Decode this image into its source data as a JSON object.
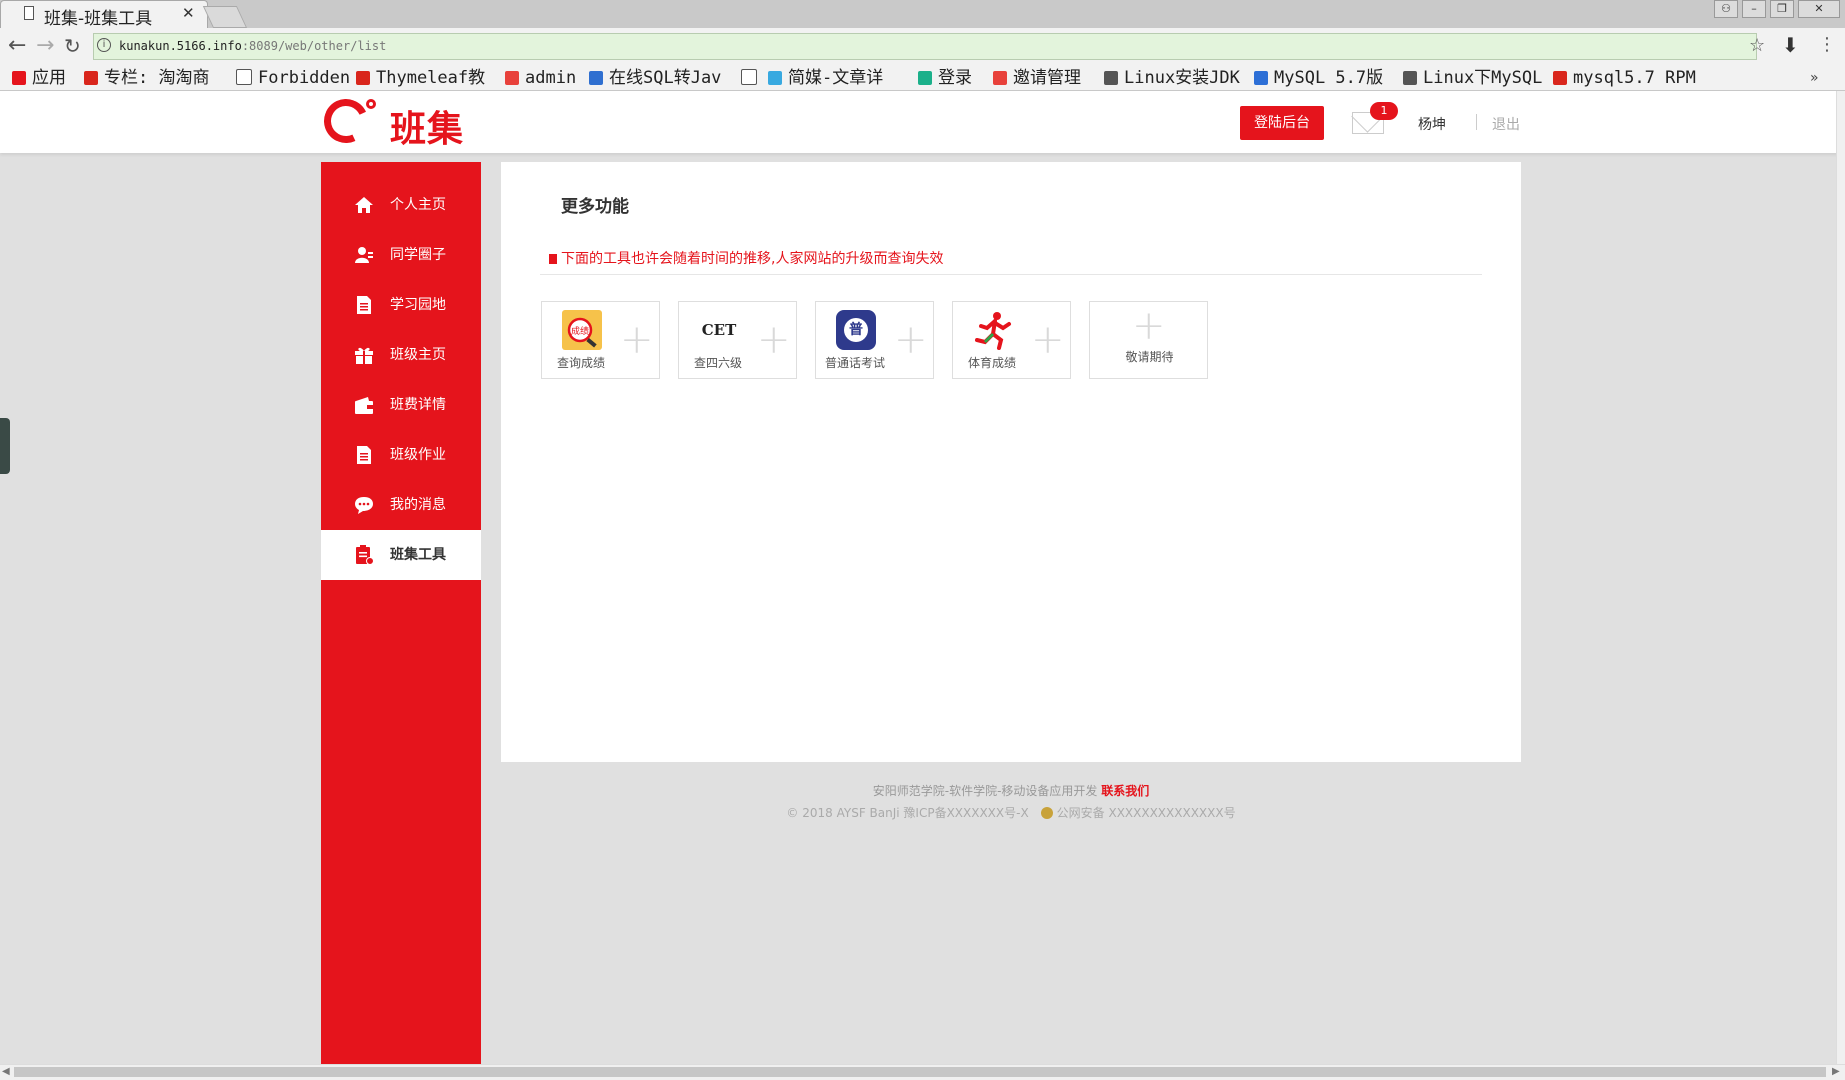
{
  "browser": {
    "tab_title": "班集-班集工具",
    "url_host": "kunakun.5166.info",
    "url_path": ":8089/web/other/list",
    "bookmarks": [
      {
        "label": "应用",
        "icon": "apps-grid-icon",
        "color": "#e5141c"
      },
      {
        "label": "专栏: 淘淘商",
        "icon": "csdn-icon",
        "color": "#d9261c"
      },
      {
        "label": "Forbidden",
        "icon": "page-icon",
        "color": "#ffffff"
      },
      {
        "label": "Thymeleaf教",
        "icon": "csdn-icon",
        "color": "#d9261c"
      },
      {
        "label": "admin",
        "icon": "jm-icon",
        "color": "#e8413b"
      },
      {
        "label": "在线SQL转Jav",
        "icon": "code-icon",
        "color": "#2f6fd0"
      },
      {
        "label": "",
        "icon": "page-icon",
        "color": "#ffffff"
      },
      {
        "label": "简媒-文章详",
        "icon": "jm-icon",
        "color": "#38a9e0"
      },
      {
        "label": "登录",
        "icon": "leaf-icon",
        "color": "#1bb08a"
      },
      {
        "label": "邀请管理",
        "icon": "jm-icon",
        "color": "#e8413b"
      },
      {
        "label": "Linux安装JDK",
        "icon": "script-a-icon",
        "color": "#555555"
      },
      {
        "label": "MySQL 5.7版",
        "icon": "paw-icon",
        "color": "#2d6fd6"
      },
      {
        "label": "Linux下MySQL",
        "icon": "script-a-icon",
        "color": "#555555"
      },
      {
        "label": "mysql5.7 RPM",
        "icon": "csdn-icon",
        "color": "#d9261c"
      }
    ]
  },
  "header": {
    "logo_text": "班集",
    "login_button": "登陆后台",
    "badge_count": "1",
    "username": "杨坤",
    "logout": "退出"
  },
  "sidebar": {
    "items": [
      {
        "label": "个人主页",
        "icon": "home-icon"
      },
      {
        "label": "同学圈子",
        "icon": "user-circle-icon"
      },
      {
        "label": "学习园地",
        "icon": "document-icon"
      },
      {
        "label": "班级主页",
        "icon": "gift-icon"
      },
      {
        "label": "班费详情",
        "icon": "wallet-icon"
      },
      {
        "label": "班级作业",
        "icon": "document-icon"
      },
      {
        "label": "我的消息",
        "icon": "chat-icon"
      },
      {
        "label": "班集工具",
        "icon": "toolbox-icon",
        "active": true
      }
    ]
  },
  "main": {
    "title": "更多功能",
    "notice": "下面的工具也许会随着时间的推移,人家网站的升级而查询失效",
    "tools": [
      {
        "label": "查询成绩",
        "icon": "score-search-icon"
      },
      {
        "label": "查四六级",
        "icon": "cet-icon",
        "icon_text": "CET"
      },
      {
        "label": "普通话考试",
        "icon": "putonghua-icon",
        "icon_text": "普"
      },
      {
        "label": "体育成绩",
        "icon": "runner-icon"
      },
      {
        "label": "敬请期待",
        "icon": "plus-icon"
      }
    ]
  },
  "footer": {
    "line1": "安阳师范学院-软件学院-移动设备应用开发",
    "contact": "联系我们",
    "copyright": "© 2018 AYSF BanJi 豫ICP备XXXXXXX号-X",
    "police": "公网安备 XXXXXXXXXXXXXX号"
  },
  "colors": {
    "brand": "#e5141c",
    "page_bg": "#e0e0e0"
  }
}
